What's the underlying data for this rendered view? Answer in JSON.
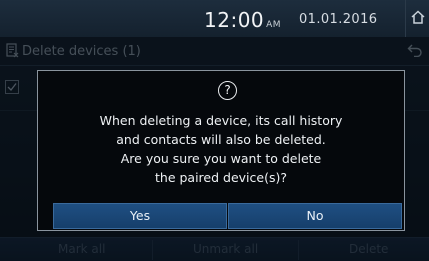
{
  "status_bar": {
    "time": "12:00",
    "ampm": "AM",
    "date": "01.01.2016",
    "home_icon": "home-icon"
  },
  "title_bar": {
    "icon": "delete-list-icon",
    "title": "Delete devices (1)",
    "back_icon": "back-arrow-icon"
  },
  "list": {
    "checkbox_icon": "checkbox-icon",
    "checked": true
  },
  "dialog": {
    "icon": "question-icon",
    "icon_glyph": "?",
    "message_lines": [
      "When deleting a device, its call history",
      "and contacts will also be deleted.",
      "Are you sure you want to delete",
      "the paired device(s)?"
    ],
    "yes_label": "Yes",
    "no_label": "No"
  },
  "bottom_bar": {
    "mark_all": "Mark all",
    "unmark_all": "Unmark all",
    "delete": "Delete"
  },
  "colors": {
    "button_blue": "#1d4a7a",
    "dialog_bg": "#05080c",
    "background": "#0d1722"
  }
}
